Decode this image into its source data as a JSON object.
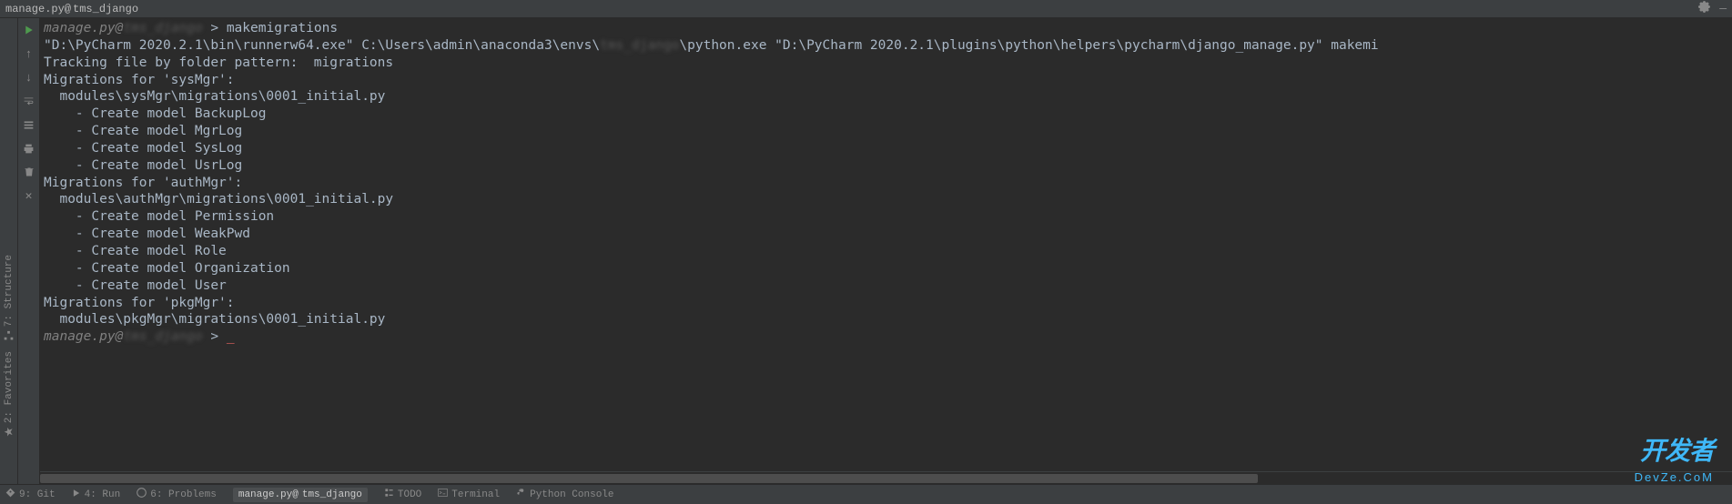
{
  "titlebar": {
    "title": "manage.py@",
    "project_blurred": "tms_django"
  },
  "toolbar": {
    "icons": [
      "play",
      "arrow-up",
      "arrow-down",
      "wrap",
      "find",
      "print",
      "trash",
      "close"
    ]
  },
  "console": {
    "prompt_prefix": "manage.py@",
    "prompt_project": "tms_django",
    "prompt_sign": " > ",
    "command": "makemigrations",
    "line1a": "\"D:\\PyCharm 2020.2.1\\bin\\runnerw64.exe\" C:\\Users\\admin\\anaconda3\\envs\\",
    "line1b": "tms_django",
    "line1c": "\\python.exe \"D:\\PyCharm 2020.2.1\\plugins\\python\\helpers\\pycharm\\django_manage.py\" makemi",
    "line2": "Tracking file by folder pattern:  migrations",
    "line3": "Migrations for 'sysMgr':",
    "line4": "  modules\\sysMgr\\migrations\\0001_initial.py",
    "line5": "    - Create model BackupLog",
    "line6": "    - Create model MgrLog",
    "line7": "    - Create model SysLog",
    "line8": "    - Create model UsrLog",
    "line9": "Migrations for 'authMgr':",
    "line10": "  modules\\authMgr\\migrations\\0001_initial.py",
    "line11": "    - Create model Permission",
    "line12": "    - Create model WeakPwd",
    "line13": "    - Create model Role",
    "line14": "    - Create model Organization",
    "line15": "    - Create model User",
    "line16": "Migrations for 'pkgMgr':",
    "line17": "  modules\\pkgMgr\\migrations\\0001_initial.py",
    "cursor": "_"
  },
  "sidebar_left": {
    "structure": "7: Structure",
    "favorites": "2: Favorites"
  },
  "statusbar": {
    "git": "9: Git",
    "run": "4: Run",
    "problems": "6: Problems",
    "manage_tab": "manage.py@",
    "manage_tab_blurred": "tms_django",
    "todo": "TODO",
    "terminal": "Terminal",
    "python_console": "Python Console"
  },
  "watermark": {
    "main": "开发者",
    "sub": "DevZe.CoM"
  }
}
